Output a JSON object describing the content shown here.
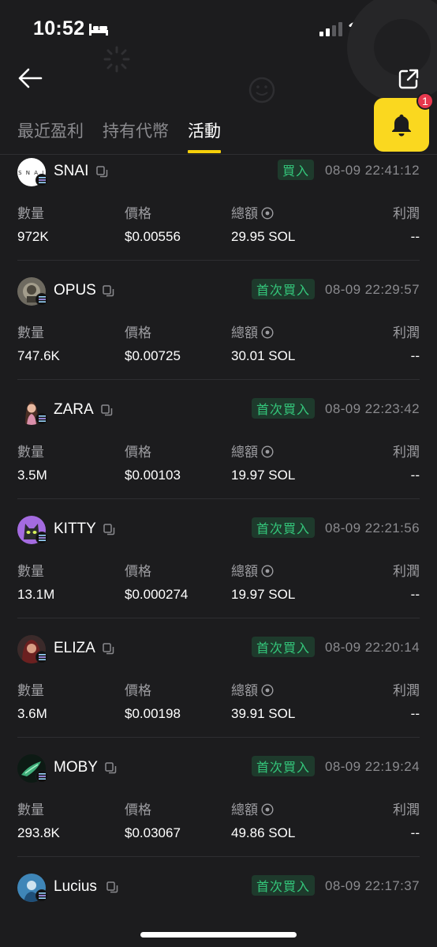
{
  "status_bar": {
    "time": "10:52"
  },
  "tabs": [
    {
      "label": "最近盈利"
    },
    {
      "label": "持有代幣"
    },
    {
      "label": "活動"
    }
  ],
  "notification": {
    "count": "1"
  },
  "columns": {
    "quantity": "數量",
    "price": "價格",
    "total": "總額",
    "profit": "利潤"
  },
  "activities": [
    {
      "token": "SNAI",
      "action": "買入",
      "time": "08-09 22:41:12",
      "quantity": "972K",
      "price": "$0.00556",
      "total": "29.95 SOL",
      "profit": "--"
    },
    {
      "token": "OPUS",
      "action": "首次買入",
      "time": "08-09 22:29:57",
      "quantity": "747.6K",
      "price": "$0.00725",
      "total": "30.01 SOL",
      "profit": "--"
    },
    {
      "token": "ZARA",
      "action": "首次買入",
      "time": "08-09 22:23:42",
      "quantity": "3.5M",
      "price": "$0.00103",
      "total": "19.97 SOL",
      "profit": "--"
    },
    {
      "token": "KITTY",
      "action": "首次買入",
      "time": "08-09 22:21:56",
      "quantity": "13.1M",
      "price": "$0.000274",
      "total": "19.97 SOL",
      "profit": "--"
    },
    {
      "token": "ELIZA",
      "action": "首次買入",
      "time": "08-09 22:20:14",
      "quantity": "3.6M",
      "price": "$0.00198",
      "total": "39.91 SOL",
      "profit": "--"
    },
    {
      "token": "MOBY",
      "action": "首次買入",
      "time": "08-09 22:19:24",
      "quantity": "293.8K",
      "price": "$0.03067",
      "total": "49.86 SOL",
      "profit": "--"
    },
    {
      "token": "Lucius",
      "action": "首次買入",
      "time": "08-09 22:17:37"
    }
  ],
  "colors": {
    "accent": "#fad81f",
    "buy": "#34c77b",
    "badge": "#e6374d",
    "background": "#1c1c1e"
  },
  "icons": [
    "back-arrow-icon",
    "share-icon",
    "bell-icon",
    "copy-icon",
    "info-icon",
    "solana-icon"
  ]
}
